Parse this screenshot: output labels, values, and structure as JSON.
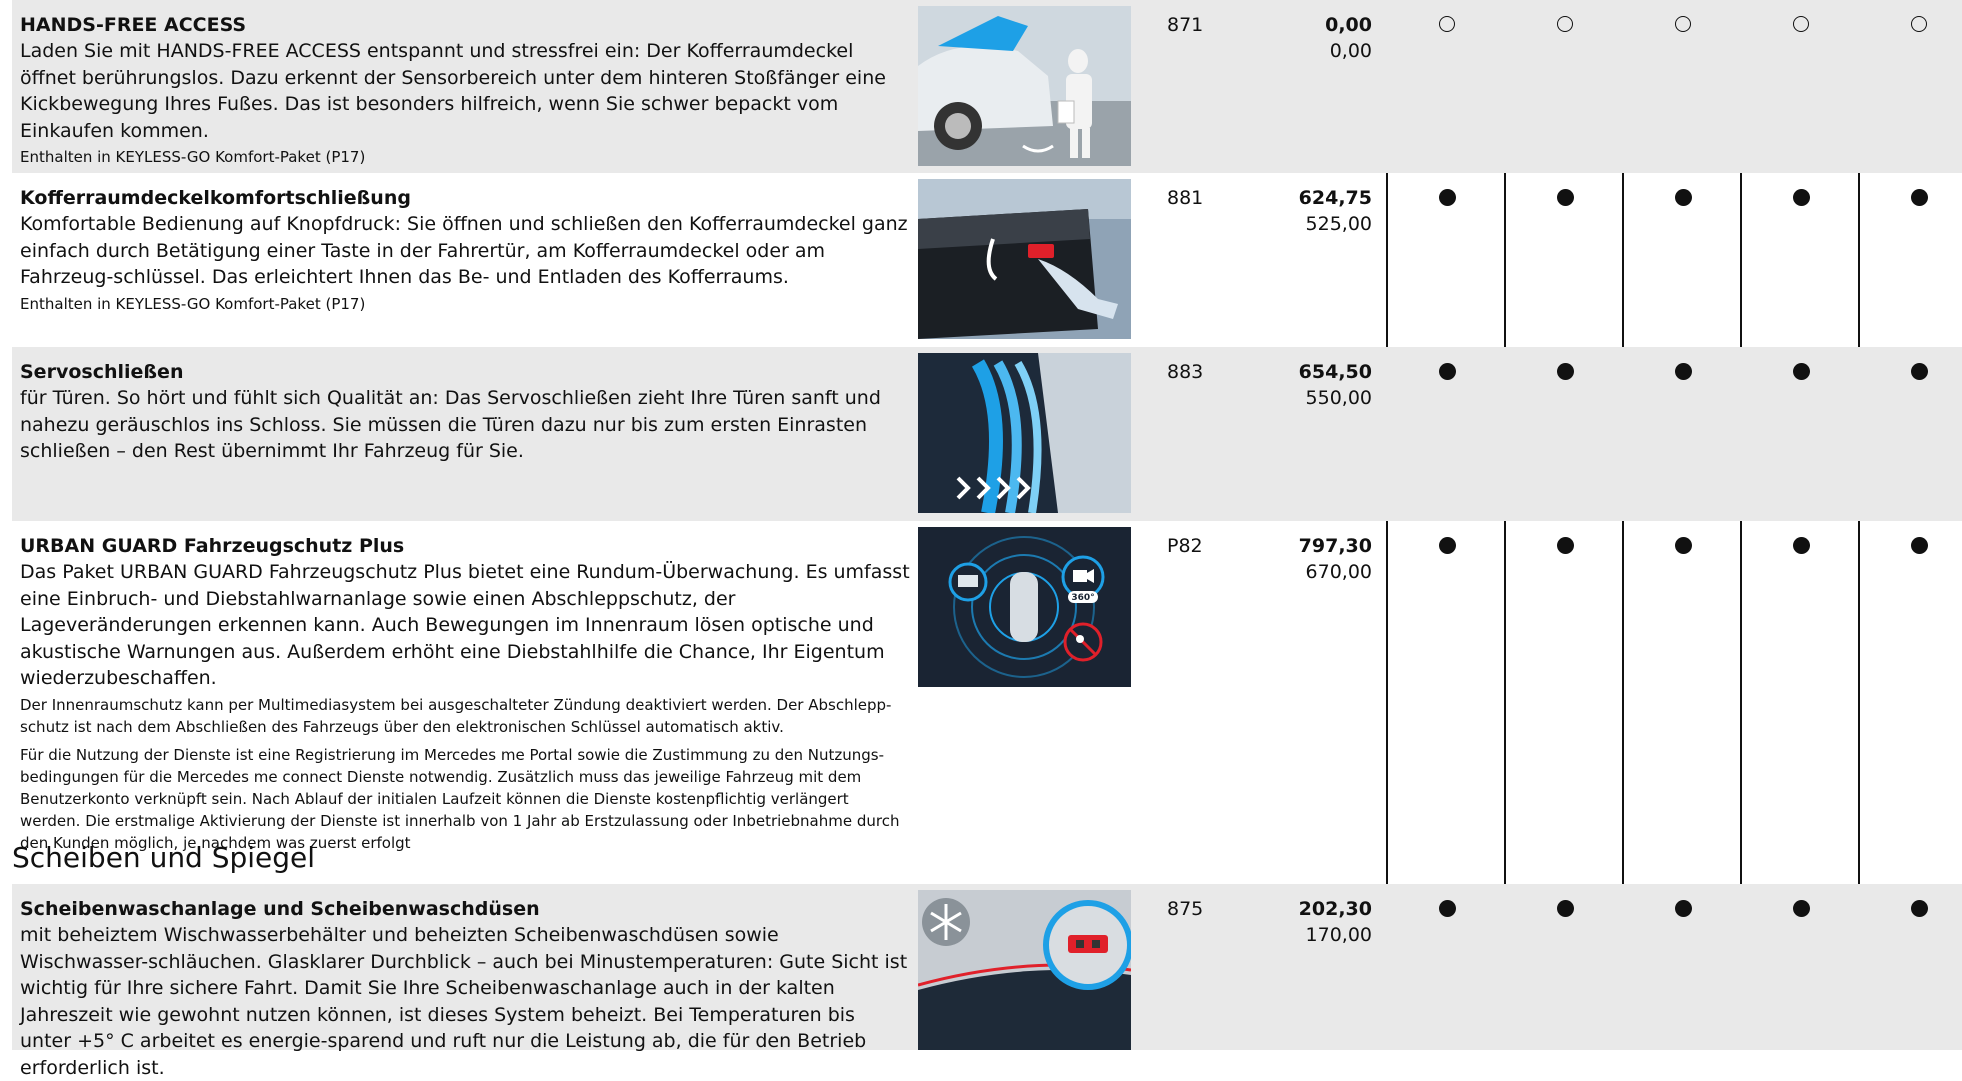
{
  "rows": [
    {
      "title": "HANDS-FREE ACCESS",
      "desc": "Laden Sie mit HANDS-FREE ACCESS entspannt und stressfrei ein: Der Kofferraumdeckel öffnet berührungslos. Dazu erkennt der Sensorbereich unter dem hinteren Stoßfänger eine Kickbewegung Ihres Fußes. Das ist besonders hilfreich, wenn Sie schwer bepackt vom Einkaufen kommen.",
      "note": "Enthalten in KEYLESS-GO Komfort-Paket (P17)",
      "code": "871",
      "price_gross": "0,00",
      "price_net": "0,00",
      "availability": [
        "○",
        "○",
        "○",
        "○",
        "○"
      ],
      "image": "hands-free-tailgate-image"
    },
    {
      "title": "Kofferraumdeckelkomfortschließung",
      "desc": "Komfortable Bedienung auf Knopfdruck: Sie öffnen und schließen den Kofferraumdeckel ganz einfach durch Betätigung einer Taste in der Fahrertür, am Kofferraumdeckel oder am Fahrzeug-schlüssel. Das erleichtert Ihnen das Be- und Entladen des Kofferraums.",
      "note": "Enthalten in KEYLESS-GO Komfort-Paket (P17)",
      "code": "881",
      "price_gross": "624,75",
      "price_net": "525,00",
      "availability": [
        "●",
        "●",
        "●",
        "●",
        "●"
      ],
      "image": "tailgate-button-image"
    },
    {
      "title": "Servoschließen",
      "desc": "für Türen. So hört und fühlt sich Qualität an: Das Servoschließen zieht Ihre Türen sanft und nahezu geräuschlos ins Schloss. Sie müssen die Türen dazu nur bis zum ersten Einrasten schließen – den Rest übernimmt Ihr Fahrzeug für Sie.",
      "code": "883",
      "price_gross": "654,50",
      "price_net": "550,00",
      "availability": [
        "●",
        "●",
        "●",
        "●",
        "●"
      ],
      "image": "soft-close-door-image"
    },
    {
      "title": "URBAN GUARD Fahrzeugschutz Plus",
      "desc": "Das Paket URBAN GUARD Fahrzeugschutz Plus bietet eine Rundum-Überwachung. Es umfasst eine Einbruch- und Diebstahlwarnanlage sowie einen Abschleppschutz, der Lageveränderungen erkennen kann. Auch Bewegungen im Innenraum lösen optische und akustische Warnungen aus. Außerdem erhöht eine Diebstahlhilfe die Chance, Ihr Eigentum wiederzubeschaffen.",
      "note": "Der Innenraumschutz kann per Multimediasystem bei ausgeschalteter Zündung deaktiviert werden. Der Abschlepp-schutz ist nach dem Abschließen des Fahrzeugs über den elektronischen Schlüssel automatisch aktiv.",
      "note2": "Für die Nutzung der Dienste ist eine Registrierung im Mercedes me Portal sowie die Zustimmung zu den Nutzungs-bedingungen für die Mercedes me connect Dienste notwendig. Zusätzlich muss das jeweilige Fahrzeug mit dem Benutzerkonto verknüpft sein. Nach Ablauf der initialen Laufzeit können die Dienste kostenpflichtig verlängert werden. Die erstmalige Aktivierung der Dienste ist innerhalb von 1 Jahr ab Erstzulassung oder Inbetriebnahme durch den Kunden möglich, je nachdem was zuerst erfolgt",
      "code": "P82",
      "price_gross": "797,30",
      "price_net": "670,00",
      "availability": [
        "●",
        "●",
        "●",
        "●",
        "●"
      ],
      "image": "urban-guard-image",
      "badge": "360°"
    },
    {
      "title": "Scheibenwaschanlage und Scheibenwaschdüsen",
      "desc": "mit beheiztem Wischwasserbehälter und beheizten Scheibenwaschdüsen sowie Wischwasser-schläuchen. Glasklarer Durchblick – auch bei Minustemperaturen: Gute Sicht ist wichtig für Ihre sichere Fahrt. Damit Sie Ihre Scheibenwaschanlage auch in der kalten Jahreszeit wie gewohnt nutzen können, ist dieses System beheizt. Bei Temperaturen bis unter +5° C arbeitet es energie-sparend und ruft nur die Leistung ab, die für den Betrieb erforderlich ist.",
      "code": "875",
      "price_gross": "202,30",
      "price_net": "170,00",
      "availability": [
        "●",
        "●",
        "●",
        "●",
        "●"
      ],
      "image": "heated-washer-image"
    }
  ],
  "section_heading": "Scheiben und Spiegel",
  "colors": {
    "row_shade": "#e9e9e9",
    "rule": "#111111",
    "accent_blue": "#1ea0e6",
    "accent_red": "#e0202a"
  }
}
